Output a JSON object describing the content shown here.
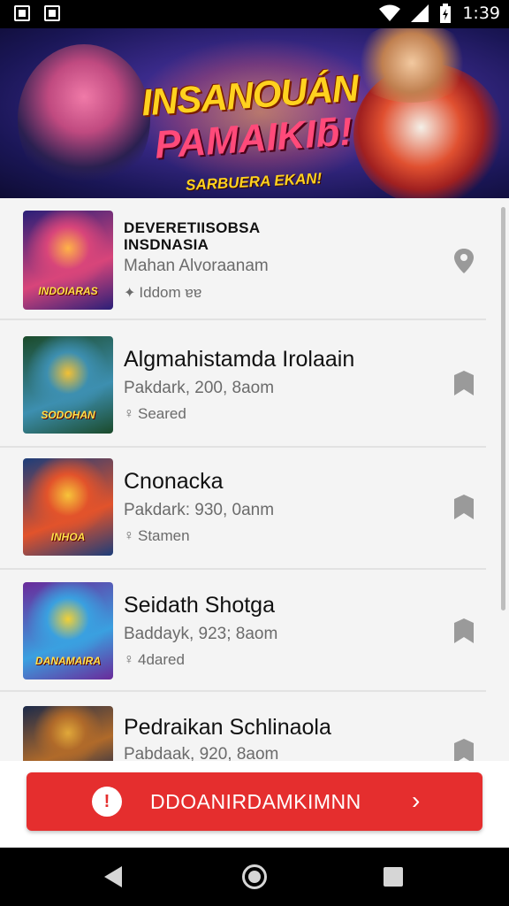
{
  "status_bar": {
    "time": "1:39"
  },
  "banner": {
    "title_line1": "INSANOUÁN",
    "title_line2": "PAMAIKIƃ!",
    "subtitle": "SARBUERA EKAN!"
  },
  "items": [
    {
      "title": "DEVERETIISOBSA INSDNASIA",
      "subtitle": "Mahan Alvoraanam",
      "meta": "Iddom ɐɐ",
      "meta_icon": "puzzle-icon",
      "action_icon": "location-pin-icon",
      "thumb_label": "INDOIARAS",
      "thumb_colors": [
        "#2a1f78",
        "#d8457a",
        "#ffb347"
      ]
    },
    {
      "title": "Algmahistamda Irolaain",
      "subtitle": "Pakdark, 200, 8aom",
      "meta": "Seared",
      "meta_icon": "tag-icon",
      "action_icon": "bookmark-icon",
      "thumb_label": "SODOHAN",
      "thumb_colors": [
        "#1b4a2a",
        "#3d8fb0",
        "#f2c035"
      ]
    },
    {
      "title": "Cnonacka",
      "subtitle": "Pakdark: 930, 0anm",
      "meta": "Stamen",
      "meta_icon": "tag-icon",
      "action_icon": "bookmark-icon",
      "thumb_label": "INHOA",
      "thumb_colors": [
        "#1c3d7a",
        "#e2532b",
        "#f7c43a"
      ]
    },
    {
      "title": "Seidath Shotga",
      "subtitle": "Baddayk, 923; 8aom",
      "meta": "4dared",
      "meta_icon": "tag-icon",
      "action_icon": "bookmark-icon",
      "thumb_label": "DANAMAIRA",
      "thumb_colors": [
        "#6a2a9a",
        "#3aa0e0",
        "#f2d035"
      ]
    },
    {
      "title": "Pedraikan Schlinaola",
      "subtitle": "Pabdaak, 920, 8aom",
      "meta": "",
      "meta_icon": "",
      "action_icon": "bookmark-icon",
      "thumb_label": "",
      "thumb_colors": [
        "#1c2a4a",
        "#b06a2a",
        "#e0a83a"
      ]
    }
  ],
  "cta": {
    "label": "DDOANIRDAMKIMNN",
    "icon": "alert-icon",
    "chevron": "chevron-right-icon",
    "color": "#e52e2e"
  }
}
